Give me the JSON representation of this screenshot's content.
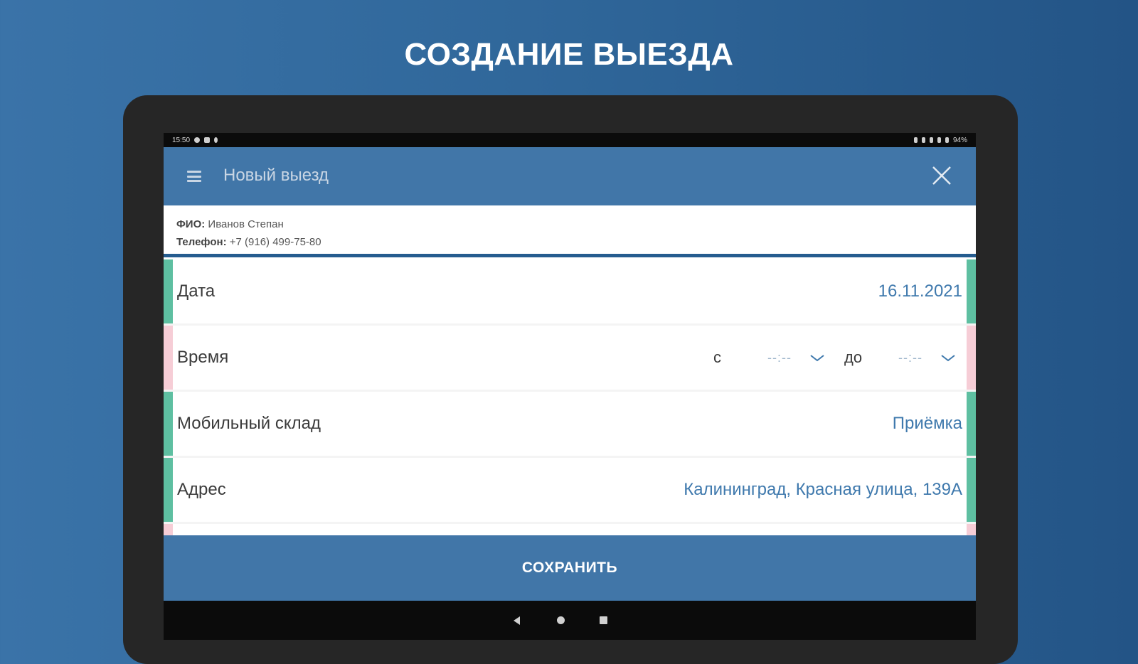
{
  "promo": {
    "title": "СОЗДАНИЕ ВЫЕЗДА"
  },
  "statusbar": {
    "time": "15:50",
    "battery": "94%"
  },
  "appbar": {
    "title": "Новый выезд",
    "menu_icon": "hamburger-menu-icon",
    "close_icon": "close-icon"
  },
  "client": {
    "name_label": "ФИО:",
    "name_value": "Иванов Степан",
    "phone_label": "Телефон:",
    "phone_value": "+7 (916) 499-75-80"
  },
  "form": {
    "date": {
      "label": "Дата",
      "value": "16.11.2021"
    },
    "time": {
      "label": "Время",
      "from_label": "с",
      "from_value": "--:--",
      "to_label": "до",
      "to_value": "--:--"
    },
    "warehouse": {
      "label": "Мобильный склад",
      "value": "Приёмка"
    },
    "address": {
      "label": "Адрес",
      "value": "Калининград, Красная улица, 139А"
    }
  },
  "actions": {
    "save_label": "СОХРАНИТЬ"
  },
  "colors": {
    "accent": "#4176a8",
    "valid": "#5ebfa1",
    "invalid": "#f6cdd6",
    "value_text": "#3f79ad"
  }
}
